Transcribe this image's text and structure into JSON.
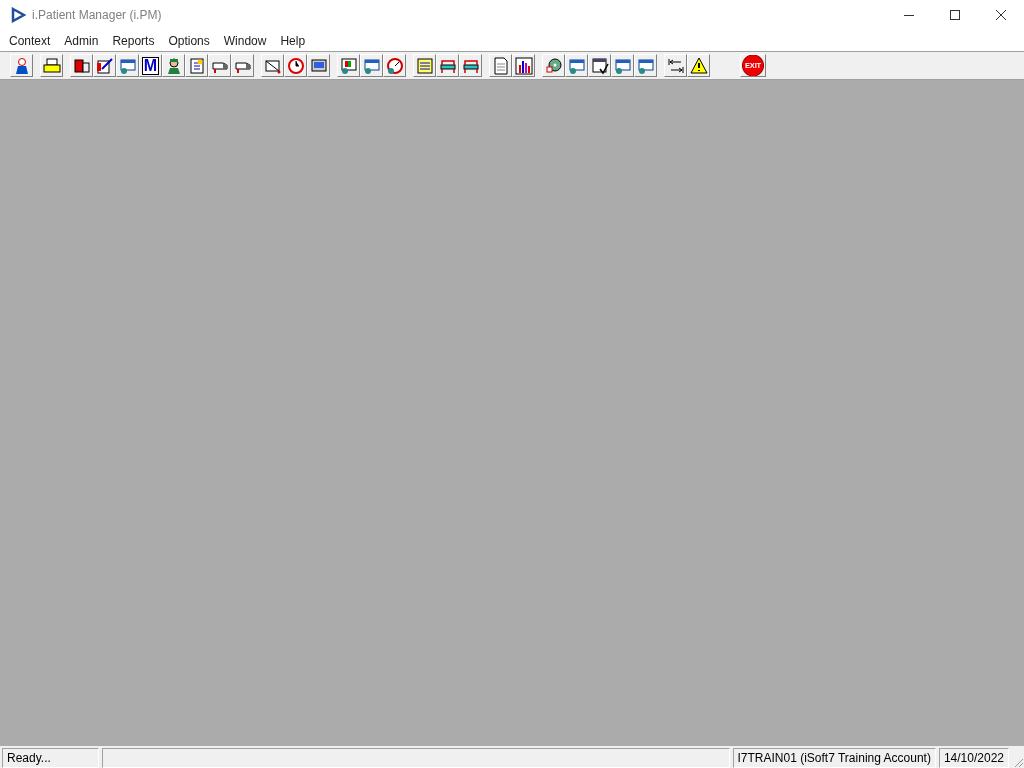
{
  "window": {
    "title": "i.Patient Manager (i.PM)"
  },
  "menu": [
    "Context",
    "Admin",
    "Reports",
    "Options",
    "Window",
    "Help"
  ],
  "toolbar": [
    [
      {
        "kind": "person"
      }
    ],
    [
      {
        "kind": "printer"
      }
    ],
    [
      {
        "kind": "book"
      },
      {
        "kind": "pen"
      },
      {
        "kind": "card"
      },
      {
        "kind": "glyph",
        "glyph": "M"
      },
      {
        "kind": "nurse"
      },
      {
        "kind": "note"
      },
      {
        "kind": "hand"
      },
      {
        "kind": "hand"
      }
    ],
    [
      {
        "kind": "envelope"
      },
      {
        "kind": "clock"
      },
      {
        "kind": "monitor"
      }
    ],
    [
      {
        "kind": "picture"
      },
      {
        "kind": "card"
      },
      {
        "kind": "gauge"
      }
    ],
    [
      {
        "kind": "memo"
      },
      {
        "kind": "bed"
      },
      {
        "kind": "bed"
      }
    ],
    [
      {
        "kind": "page"
      },
      {
        "kind": "chart"
      }
    ],
    [
      {
        "kind": "disc"
      },
      {
        "kind": "card"
      },
      {
        "kind": "form"
      },
      {
        "kind": "card"
      },
      {
        "kind": "card"
      }
    ],
    [
      {
        "kind": "arrows"
      },
      {
        "kind": "warning"
      }
    ],
    [
      {
        "kind": "stop",
        "text": "EXIT"
      }
    ]
  ],
  "status_bar": [
    "Ready...",
    "I7TRAIN01 (iSoft7 Training Account)",
    "14/10/2022"
  ]
}
